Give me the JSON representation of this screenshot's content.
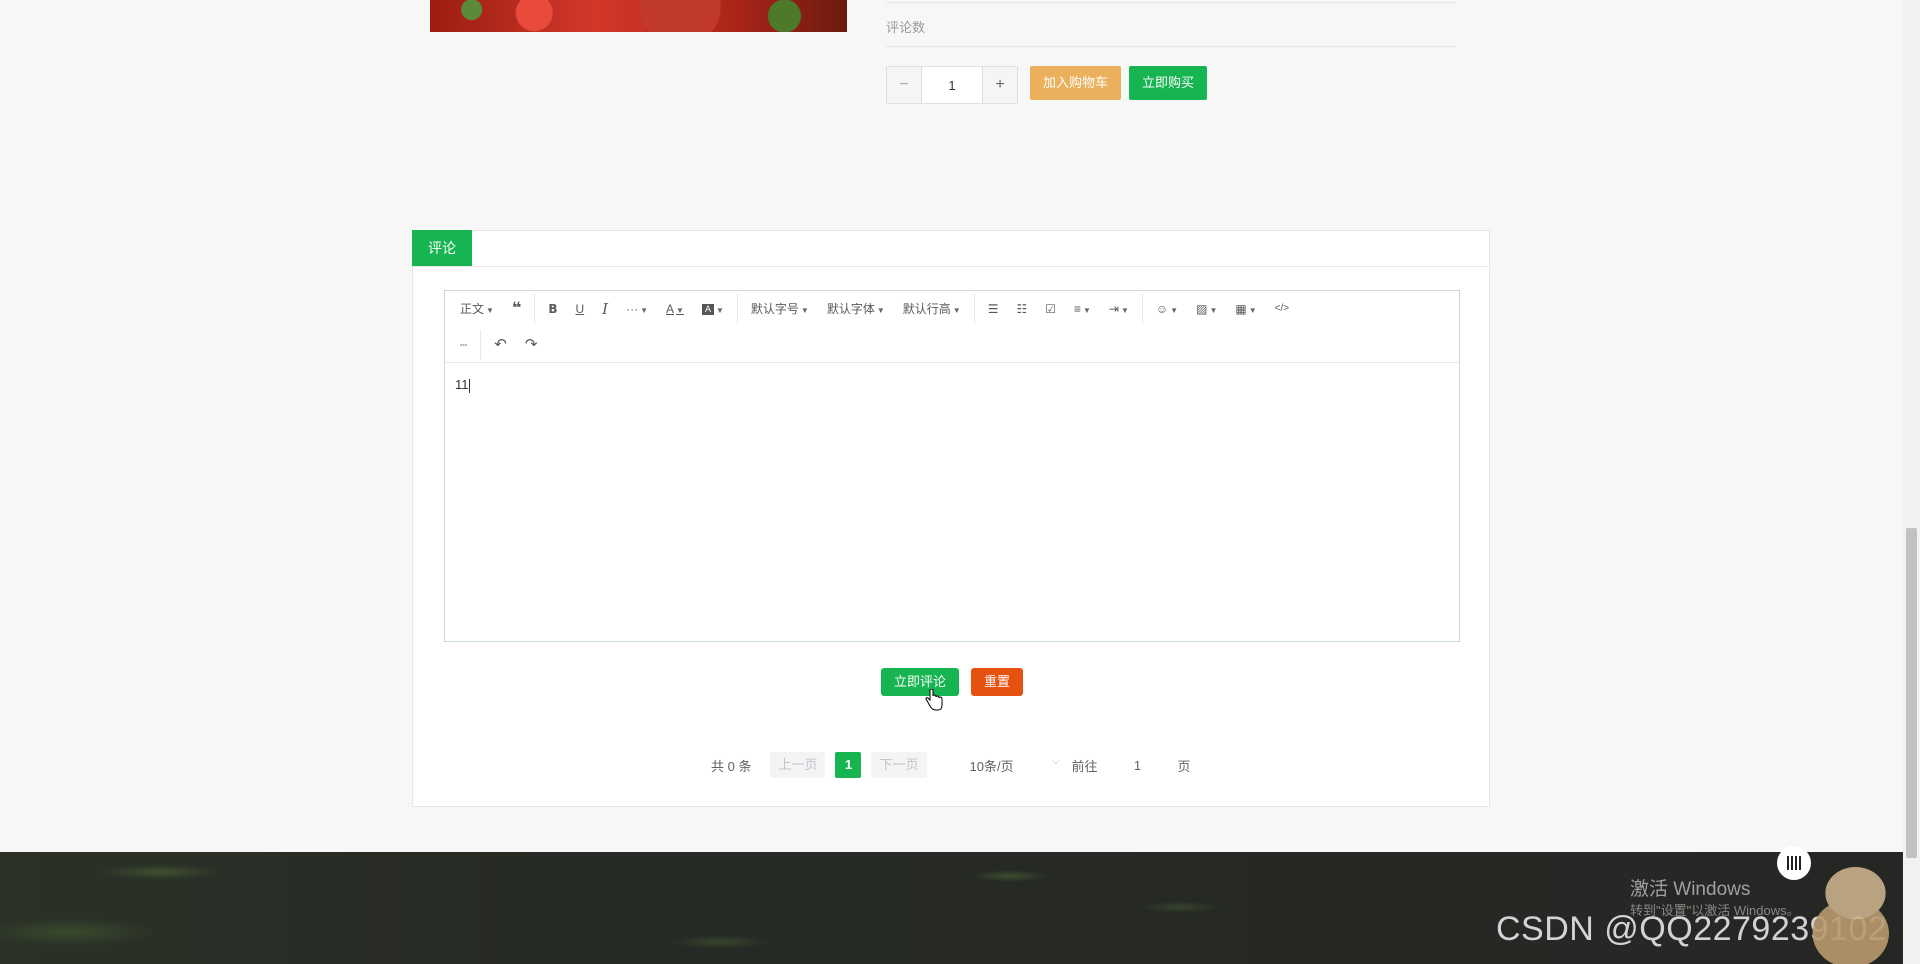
{
  "product": {
    "comment_count_label": "评论数",
    "quantity_value": "1",
    "qty_minus": "−",
    "qty_plus": "+",
    "add_to_cart": "加入购物车",
    "buy_now": "立即购买"
  },
  "comments": {
    "tab_label": "评论",
    "toolbar": {
      "paragraph": "正文",
      "font_size": "默认字号",
      "font_family": "默认字体",
      "line_height": "默认行高",
      "icons": [
        "quote-icon",
        "bold-icon",
        "underline-icon",
        "italic-icon",
        "more-icon",
        "font-color-icon",
        "bg-color-icon",
        "bullet-list-icon",
        "numbered-list-icon",
        "todo-icon",
        "align-icon",
        "indent-icon",
        "emoji-icon",
        "image-icon",
        "table-icon",
        "code-icon",
        "divider-icon",
        "undo-icon",
        "redo-icon"
      ]
    },
    "editor_text": "11",
    "submit": "立即评论",
    "reset": "重置"
  },
  "pagination": {
    "total": "共 0 条",
    "prev": "上一页",
    "current_page": "1",
    "next": "下一页",
    "page_size": "10条/页",
    "goto_label": "前往",
    "goto_value": "1",
    "goto_suffix": "页"
  },
  "overlay": {
    "activate_windows": "激活 Windows",
    "activate_windows_sub": "转到\"设置\"以激活 Windows。",
    "csdn_watermark": "CSDN @QQ2279239102"
  },
  "colors": {
    "accent_green": "#16b551",
    "cart_orange": "#eab05c",
    "reset_red": "#e5520f"
  }
}
